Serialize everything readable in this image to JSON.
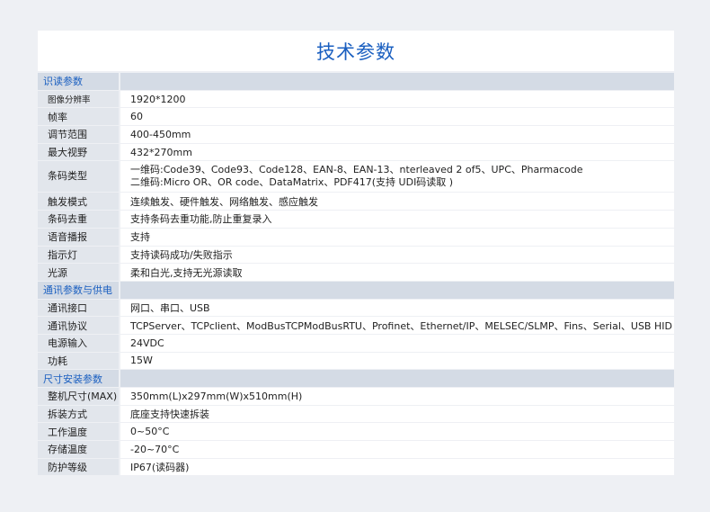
{
  "title": "技术参数",
  "sections": [
    {
      "heading": "识读参数",
      "rows": [
        {
          "label": "图像分辨率",
          "value": "1920*1200",
          "small": true
        },
        {
          "label": "帧率",
          "value": "60"
        },
        {
          "label": "调节范围",
          "value": "400-450mm"
        },
        {
          "label": "最大视野",
          "value": "432*270mm"
        },
        {
          "label": "条码类型",
          "value": "一维码:Code39、Code93、Code128、EAN-8、EAN-13、nterleaved 2 of5、UPC、Pharmacode",
          "value2": "二维码:Micro OR、OR code、DataMatrix、PDF417(支持 UDI码读取 )"
        },
        {
          "label": "触发模式",
          "value": "连续触发、硬件触发、网络触发、感应触发"
        },
        {
          "label": "条码去重",
          "value": "支持条码去重功能,防止重复录入"
        },
        {
          "label": "语音播报",
          "value": "支持"
        },
        {
          "label": "指示灯",
          "value": "支持读码成功/失败指示"
        },
        {
          "label": "光源",
          "value": "柔和白光,支持无光源读取"
        }
      ]
    },
    {
      "heading": "通讯参数与供电",
      "rows": [
        {
          "label": "通讯接口",
          "value": "网口、串口、USB"
        },
        {
          "label": "通讯协议",
          "value": "TCPServer、TCPclient、ModBusTCPModBusRTU、Profinet、Ethernet/IP、MELSEC/SLMP、Fins、Serial、USB HID"
        },
        {
          "label": "电源输入",
          "value": "24VDC"
        },
        {
          "label": "功耗",
          "value": "15W"
        }
      ]
    },
    {
      "heading": "尺寸安装参数",
      "rows": [
        {
          "label": "整机尺寸(MAX)",
          "value": "350mm(L)x297mm(W)x510mm(H)"
        },
        {
          "label": "拆装方式",
          "value": "底座支持快速拆装"
        },
        {
          "label": "工作温度",
          "value": "0~50°C"
        },
        {
          "label": "存储温度",
          "value": "-20~70°C"
        },
        {
          "label": "防护等级",
          "value": "IP67(读码器)"
        }
      ]
    }
  ]
}
